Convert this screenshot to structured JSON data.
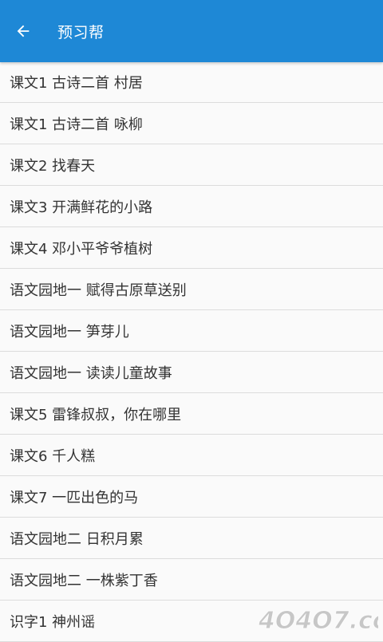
{
  "app_bar": {
    "title": "预习帮",
    "back_icon": "arrow-left-icon",
    "color": "#1e88d6"
  },
  "lessons": [
    "课文1 古诗二首 村居",
    "课文1 古诗二首 咏柳",
    "课文2 找春天",
    "课文3 开满鲜花的小路",
    "课文4 邓小平爷爷植树",
    "语文园地一 赋得古原草送别",
    "语文园地一 笋芽儿",
    "语文园地一 读读儿童故事",
    "课文5 雷锋叔叔，你在哪里",
    "课文6 千人糕",
    "课文7 一匹出色的马",
    "语文园地二 日积月累",
    "语文园地二 一株紫丁香",
    "识字1 神州谣"
  ],
  "watermark": {
    "text": "4O4O7.com"
  }
}
